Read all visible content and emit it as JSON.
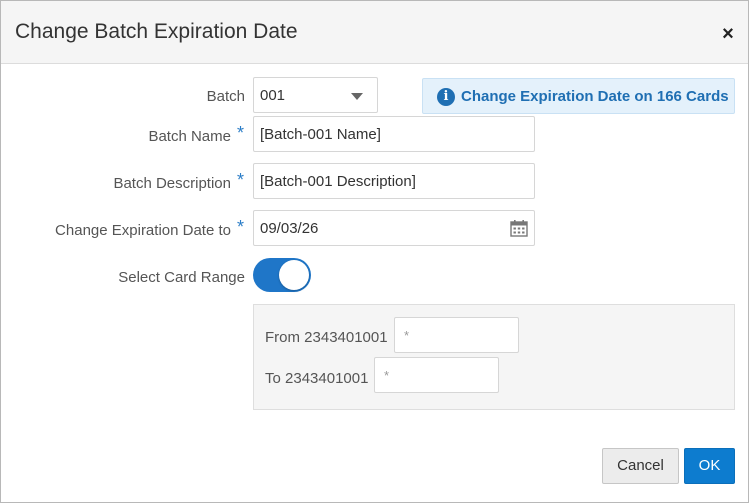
{
  "dialog": {
    "title": "Change Batch Expiration Date",
    "close_label": "×"
  },
  "form": {
    "batch": {
      "label": "Batch",
      "selected": "001"
    },
    "batch_name": {
      "label": "Batch Name",
      "required_mark": "*",
      "value": "[Batch-001 Name]"
    },
    "batch_description": {
      "label": "Batch Description",
      "required_mark": "*",
      "value": "[Batch-001 Description]"
    },
    "expiration_date": {
      "label": "Change Expiration Date to",
      "required_mark": "*",
      "value": "09/03/26"
    },
    "select_card_range": {
      "label": "Select Card Range",
      "enabled": true
    }
  },
  "info_button": {
    "icon_glyph": "i",
    "label": "Change Expiration Date on 166 Cards"
  },
  "card_range": {
    "from_label": "From 2343401001",
    "from_placeholder": "*",
    "to_label": "To 2343401001",
    "to_placeholder": "*"
  },
  "footer": {
    "cancel_label": "Cancel",
    "ok_label": "OK"
  },
  "colors": {
    "accent": "#0d7ccf",
    "required": "#2b7dc7",
    "info_bg": "#e4f1fb"
  }
}
